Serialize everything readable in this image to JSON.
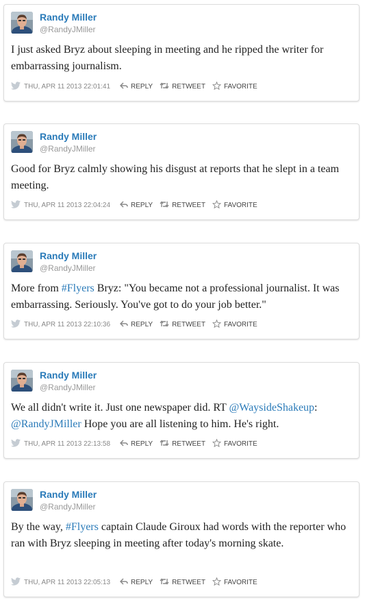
{
  "actions": {
    "reply": "REPLY",
    "retweet": "RETWEET",
    "favorite": "FAVORITE"
  },
  "tweets": [
    {
      "name": "Randy Miller",
      "handle": "@RandyJMiller",
      "timestamp": "THU, APR 11 2013 22:01:41",
      "segments": [
        {
          "t": "I just asked Bryz about sleeping in meeting and he ripped the writer for embarrassing journalism."
        }
      ]
    },
    {
      "name": "Randy Miller",
      "handle": "@RandyJMiller",
      "timestamp": "THU, APR 11 2013 22:04:24",
      "segments": [
        {
          "t": "Good for Bryz calmly showing his disgust at reports that he slept in a team meeting."
        }
      ]
    },
    {
      "name": "Randy Miller",
      "handle": "@RandyJMiller",
      "timestamp": "THU, APR 11 2013 22:10:36",
      "segments": [
        {
          "t": "More from "
        },
        {
          "t": "#Flyers",
          "link": true
        },
        {
          "t": " Bryz: \"You became not a professional journalist. It was embarrassing. Seriously. You've got to do your job better.\""
        }
      ]
    },
    {
      "name": "Randy Miller",
      "handle": "@RandyJMiller",
      "timestamp": "THU, APR 11 2013 22:13:58",
      "segments": [
        {
          "t": "We all didn't write it. Just one newspaper did. RT "
        },
        {
          "t": "@WaysideShakeup",
          "link": true
        },
        {
          "t": ": "
        },
        {
          "t": "@RandyJMiller",
          "link": true
        },
        {
          "t": " Hope you are all listening to him. He's right."
        }
      ]
    },
    {
      "name": "Randy Miller",
      "handle": "@RandyJMiller",
      "timestamp": "THU, APR 11 2013 22:05:13",
      "segments": [
        {
          "t": "By the way, "
        },
        {
          "t": "#Flyers",
          "link": true
        },
        {
          "t": " captain Claude Giroux had words with the reporter who ran with Bryz sleeping in meeting after today's morning skate."
        }
      ]
    }
  ],
  "colors": {
    "link": "#2b7bb9",
    "text": "#222222",
    "meta": "#999999"
  },
  "icons": [
    "twitter-bird-icon",
    "reply-icon",
    "retweet-icon",
    "favorite-star-icon"
  ]
}
